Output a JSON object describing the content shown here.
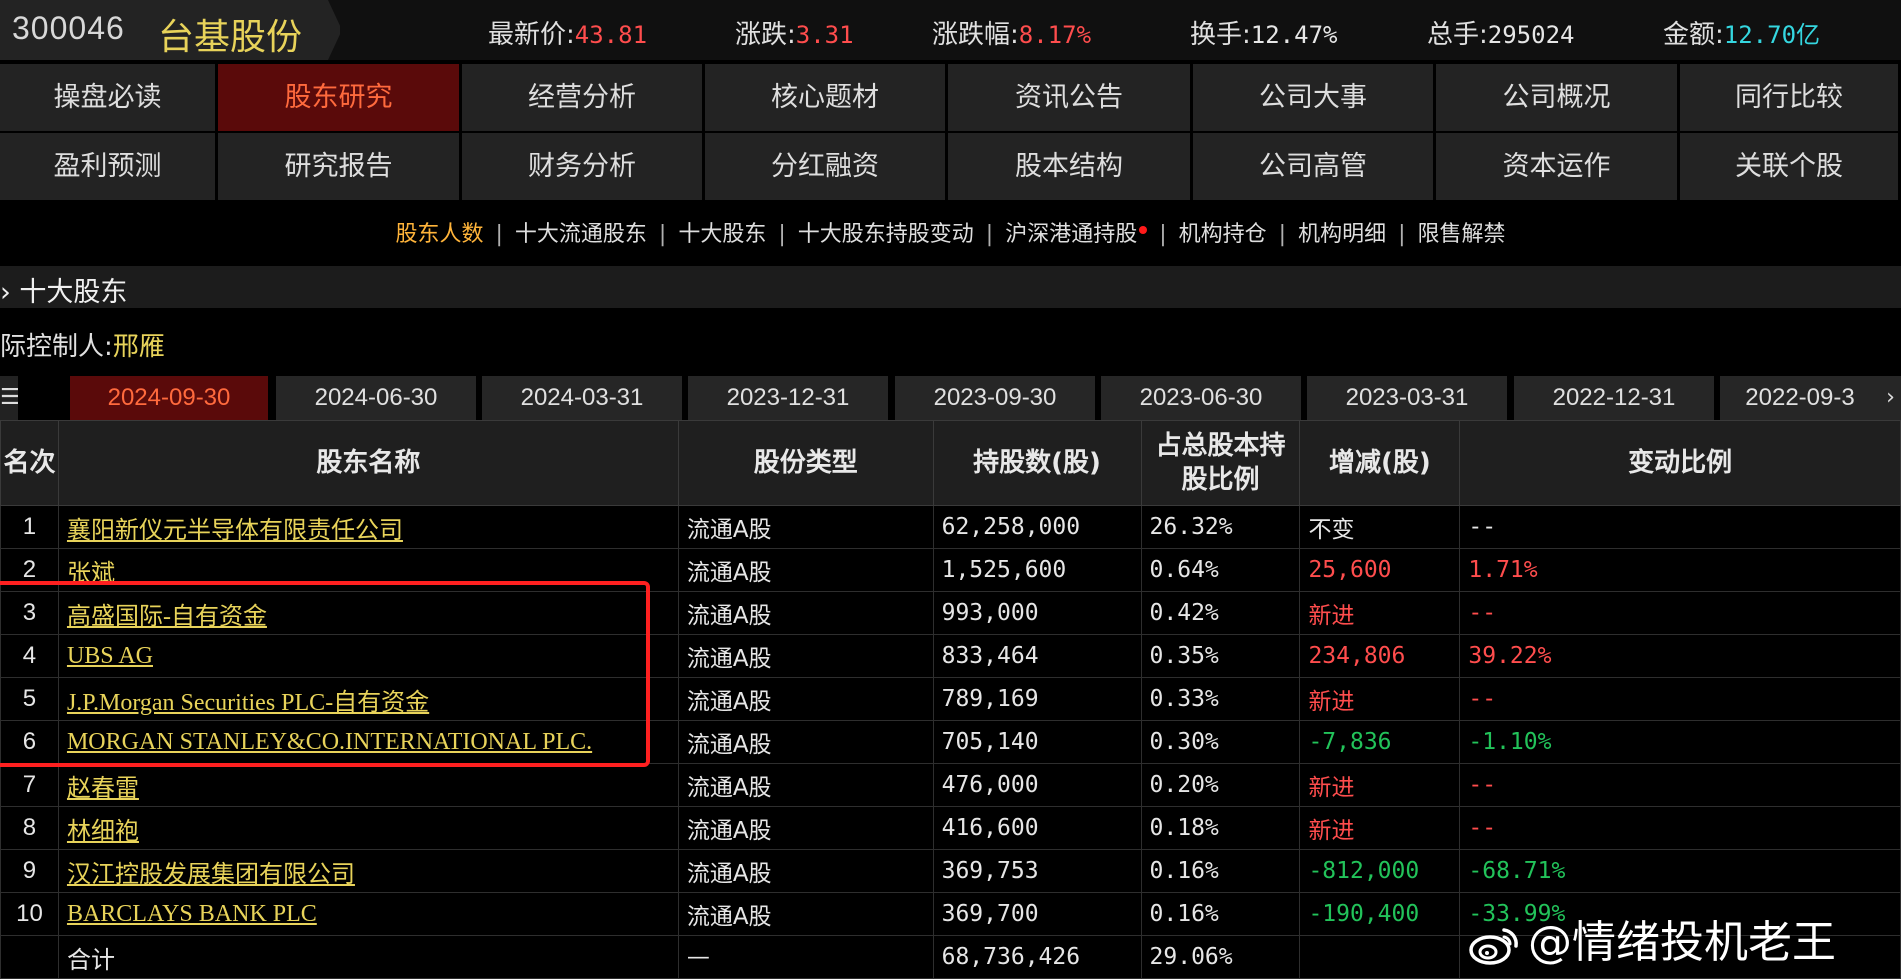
{
  "stock": {
    "code": "300046",
    "name": "台基股份"
  },
  "quote": [
    {
      "label": "最新价:",
      "value": "43.81",
      "color": "red"
    },
    {
      "label": "涨跌:",
      "value": "3.31",
      "color": "red"
    },
    {
      "label": "涨跌幅:",
      "value": "8.17%",
      "color": "red"
    },
    {
      "label": "换手:",
      "value": "12.47%",
      "color": "white"
    },
    {
      "label": "总手:",
      "value": "295024",
      "color": "white"
    },
    {
      "label": "金额:",
      "value": "12.70亿",
      "color": "cyan"
    }
  ],
  "nav_row1": [
    "操盘必读",
    "股东研究",
    "经营分析",
    "核心题材",
    "资讯公告",
    "公司大事",
    "公司概况",
    "同行比较"
  ],
  "nav_row2": [
    "盈利预测",
    "研究报告",
    "财务分析",
    "分红融资",
    "股本结构",
    "公司高管",
    "资本运作",
    "关联个股"
  ],
  "nav_active": "股东研究",
  "subnav": [
    "股东人数",
    "十大流通股东",
    "十大股东",
    "十大股东持股变动",
    "沪深港通持股",
    "机构持仓",
    "机构明细",
    "限售解禁"
  ],
  "subnav_active": "股东人数",
  "section_title": "› 十大股东",
  "controller": {
    "label": "际控制人:",
    "name": "邢雁"
  },
  "menu_icon": "menu-icon",
  "date_tabs": [
    "2024-09-30",
    "2024-06-30",
    "2024-03-31",
    "2023-12-31",
    "2023-09-30",
    "2023-06-30",
    "2023-03-31",
    "2022-12-31",
    "2022-09-3"
  ],
  "date_active": "2024-09-30",
  "next_icon": "chevron-right-icon",
  "table": {
    "headers": [
      "名次",
      "股东名称",
      "股份类型",
      "持股数(股)",
      "占总股本持股比例",
      "增减(股)",
      "变动比例"
    ],
    "rows": [
      {
        "rank": "1",
        "name": "襄阳新仪元半导体有限责任公司",
        "type": "流通A股",
        "shares": "62,258,000",
        "pct": "26.32%",
        "change": "不变",
        "change_color": "white",
        "ratio": "--",
        "ratio_color": "white"
      },
      {
        "rank": "2",
        "name": "张斌",
        "type": "流通A股",
        "shares": "1,525,600",
        "pct": "0.64%",
        "change": "25,600",
        "change_color": "red",
        "ratio": "1.71%",
        "ratio_color": "red"
      },
      {
        "rank": "3",
        "name": "高盛国际-自有资金",
        "type": "流通A股",
        "shares": "993,000",
        "pct": "0.42%",
        "change": "新进",
        "change_color": "red",
        "ratio": "--",
        "ratio_color": "red"
      },
      {
        "rank": "4",
        "name": "UBS AG",
        "type": "流通A股",
        "shares": "833,464",
        "pct": "0.35%",
        "change": "234,806",
        "change_color": "red",
        "ratio": "39.22%",
        "ratio_color": "red"
      },
      {
        "rank": "5",
        "name": "J.P.Morgan Securities PLC-自有资金",
        "type": "流通A股",
        "shares": "789,169",
        "pct": "0.33%",
        "change": "新进",
        "change_color": "red",
        "ratio": "--",
        "ratio_color": "red"
      },
      {
        "rank": "6",
        "name": "MORGAN STANLEY&CO.INTERNATIONAL PLC.",
        "type": "流通A股",
        "shares": "705,140",
        "pct": "0.30%",
        "change": "-7,836",
        "change_color": "green",
        "ratio": "-1.10%",
        "ratio_color": "green"
      },
      {
        "rank": "7",
        "name": "赵春雷",
        "type": "流通A股",
        "shares": "476,000",
        "pct": "0.20%",
        "change": "新进",
        "change_color": "red",
        "ratio": "--",
        "ratio_color": "red"
      },
      {
        "rank": "8",
        "name": "林细袍",
        "type": "流通A股",
        "shares": "416,600",
        "pct": "0.18%",
        "change": "新进",
        "change_color": "red",
        "ratio": "--",
        "ratio_color": "red"
      },
      {
        "rank": "9",
        "name": "汉江控股发展集团有限公司",
        "type": "流通A股",
        "shares": "369,753",
        "pct": "0.16%",
        "change": "-812,000",
        "change_color": "green",
        "ratio": "-68.71%",
        "ratio_color": "green"
      },
      {
        "rank": "10",
        "name": "BARCLAYS BANK PLC",
        "type": "流通A股",
        "shares": "369,700",
        "pct": "0.16%",
        "change": "-190,400",
        "change_color": "green",
        "ratio": "-33.99%",
        "ratio_color": "green"
      },
      {
        "rank": "",
        "name": "合计",
        "type": "—",
        "shares": "68,736,426",
        "pct": "29.06%",
        "change": "",
        "change_color": "white",
        "ratio": "",
        "ratio_color": "white",
        "total": true
      }
    ]
  },
  "watermark": {
    "text": "@情绪投机老王",
    "icon": "weibo-icon"
  },
  "colors": {
    "red": "#ff4d4d",
    "green": "#22c35a",
    "cyan": "#35d7e0",
    "gold": "#e8d35a",
    "active_bg": "#5a0a0a",
    "active_fg": "#ff6a3d",
    "highlight": "#ff2020"
  }
}
